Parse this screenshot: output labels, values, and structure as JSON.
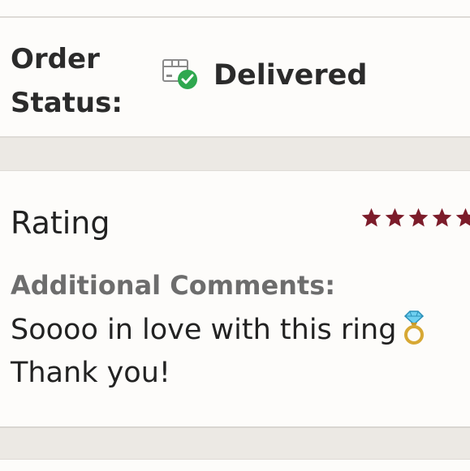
{
  "order": {
    "status_label": "Order Status:",
    "status_value": "Delivered",
    "status_icon": "delivered-box-check-icon",
    "status_color": "#2fa84f"
  },
  "review": {
    "rating_label": "Rating",
    "rating": 5,
    "star_color": "#7c1c2a",
    "comments_label": "Additional Comments:",
    "comment_line1": "Soooo in love with this ring",
    "comment_line2": "Thank you!",
    "emoji_icon": "ring-emoji-icon"
  }
}
